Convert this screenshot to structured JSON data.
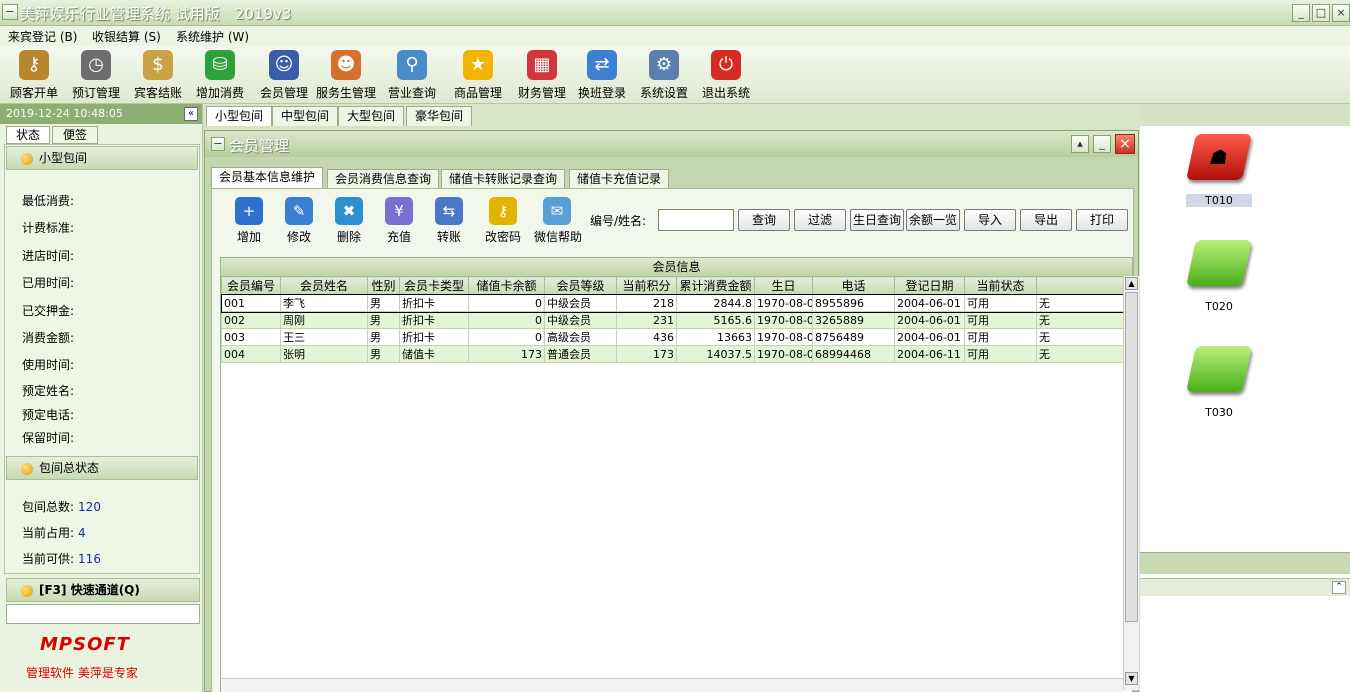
{
  "window": {
    "title": "美萍娱乐行业管理系统 试用版　2019v3"
  },
  "menu": [
    "来宾登记 (B)",
    "收银结算 (S)",
    "系统维护 (W)"
  ],
  "toolbar": [
    {
      "label": "顾客开单",
      "icon": "keys-icon",
      "color": "#b8862e",
      "glyph": "⚷"
    },
    {
      "label": "预订管理",
      "icon": "clock-icon",
      "color": "#6d6d6d",
      "glyph": "◷"
    },
    {
      "label": "宾客结账",
      "icon": "money-bag-icon",
      "color": "#caa24a",
      "glyph": "$"
    },
    {
      "label": "增加消费",
      "icon": "cups-icon",
      "color": "#2fa13c",
      "glyph": "⛁"
    },
    {
      "label": "会员管理",
      "icon": "member-icon",
      "color": "#3a5ca8",
      "glyph": "☺"
    },
    {
      "label": "服务生管理",
      "icon": "staff-icon",
      "color": "#d7702a",
      "glyph": "☻"
    },
    {
      "label": "营业查询",
      "icon": "magnifier-icon",
      "color": "#4b8bc7",
      "glyph": "⚲"
    },
    {
      "label": "商品管理",
      "icon": "star-icon",
      "color": "#f1b400",
      "glyph": "★"
    },
    {
      "label": "财务管理",
      "icon": "calculator-icon",
      "color": "#d0363b",
      "glyph": "▦"
    },
    {
      "label": "换班登录",
      "icon": "exchange-icon",
      "color": "#3f7fd0",
      "glyph": "⇄"
    },
    {
      "label": "系统设置",
      "icon": "settings-icon",
      "color": "#5b7fae",
      "glyph": "⚙"
    },
    {
      "label": "退出系统",
      "icon": "power-icon",
      "color": "#d62b22",
      "glyph": "⏻"
    }
  ],
  "left": {
    "datetime": "2019-12-24 10:48:05",
    "tabs": [
      "状态",
      "便签"
    ],
    "section1": "小型包间",
    "fields": [
      "最低消费:",
      "计费标准:",
      "进店时间:",
      "已用时间:",
      "已交押金:",
      "消费金额:",
      "使用时间:",
      "预定姓名:",
      "预定电话:",
      "保留时间:"
    ],
    "section2": "包间总状态",
    "stats": [
      {
        "label": "包间总数:",
        "value": "120"
      },
      {
        "label": "当前占用:",
        "value": "4"
      },
      {
        "label": "当前可供:",
        "value": "116"
      }
    ],
    "quick": "[F3] 快速通道(Q)",
    "logo": "MPSOFT",
    "slogan": "管理软件 美萍是专家"
  },
  "room_tabs": [
    "小型包间",
    "中型包间",
    "大型包间",
    "豪华包间"
  ],
  "rooms": [
    {
      "name": "T010",
      "status": "occupied"
    },
    {
      "name": "T020",
      "status": "free"
    },
    {
      "name": "T030",
      "status": "free"
    }
  ],
  "dialog": {
    "title": "会员管理",
    "tabs": [
      "会员基本信息维护",
      "会员消费信息查询",
      "储值卡转账记录查询",
      "储值卡充值记录"
    ],
    "ops": [
      {
        "label": "增加",
        "icon": "add-icon",
        "color": "#2f6fd0",
        "glyph": "+"
      },
      {
        "label": "修改",
        "icon": "edit-icon",
        "color": "#3b7fd0",
        "glyph": "✎"
      },
      {
        "label": "删除",
        "icon": "delete-icon",
        "color": "#2d8fd0",
        "glyph": "✖"
      },
      {
        "label": "充值",
        "icon": "recharge-icon",
        "color": "#7a6fd0",
        "glyph": "¥"
      },
      {
        "label": "转账",
        "icon": "transfer-icon",
        "color": "#4a78c8",
        "glyph": "⇆"
      },
      {
        "label": "改密码",
        "icon": "key-icon",
        "color": "#e2b400",
        "glyph": "⚷"
      },
      {
        "label": "微信帮助",
        "icon": "wechat-icon",
        "color": "#5a9ed6",
        "glyph": "✉"
      }
    ],
    "search_label": "编号/姓名:",
    "search_value": "",
    "buttons": [
      "查询",
      "过滤",
      "生日查询",
      "余额一览",
      "导入",
      "导出",
      "打印"
    ],
    "grid_title": "会员信息",
    "columns": [
      "会员编号",
      "会员姓名",
      "性别",
      "会员卡类型",
      "储值卡余额",
      "会员等级",
      "当前积分",
      "累计消费金额",
      "生日",
      "电话",
      "登记日期",
      "当前状态",
      ""
    ],
    "rows": [
      [
        "001",
        "李飞",
        "男",
        "折扣卡",
        "0",
        "中级会员",
        "218",
        "2844.8",
        "1970-08-0",
        "8955896",
        "2004-06-01",
        "可用",
        "无"
      ],
      [
        "002",
        "周刚",
        "男",
        "折扣卡",
        "0",
        "中级会员",
        "231",
        "5165.6",
        "1970-08-0",
        "3265889",
        "2004-06-01",
        "可用",
        "无"
      ],
      [
        "003",
        "王三",
        "男",
        "折扣卡",
        "0",
        "高级会员",
        "436",
        "13663",
        "1970-08-0",
        "8756489",
        "2004-06-01",
        "可用",
        "无"
      ],
      [
        "004",
        "张明",
        "男",
        "储值卡",
        "173",
        "普通会员",
        "173",
        "14037.5",
        "1970-08-0",
        "68994468",
        "2004-06-11",
        "可用",
        "无"
      ]
    ]
  }
}
